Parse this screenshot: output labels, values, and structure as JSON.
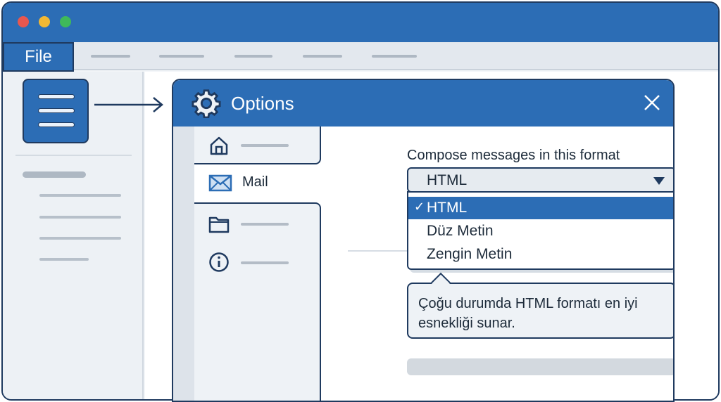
{
  "menubar": {
    "file_label": "File"
  },
  "options_dialog": {
    "title": "Options",
    "nav": {
      "mail_label": "Mail"
    },
    "compose": {
      "label": "Compose messages in this format",
      "selected_value": "HTML",
      "options": [
        "HTML",
        "Düz Metin",
        "Zengin Metin"
      ],
      "checkmark": "✓"
    },
    "tooltip_text": "Çoğu durumda HTML formatı en iyi esnekliği sunar."
  },
  "colors": {
    "accent": "#2c6db5",
    "outline": "#1f3a5f",
    "traffic_red": "#e8574f",
    "traffic_yellow": "#f2b833",
    "traffic_green": "#3fb95a"
  },
  "icons": [
    "document-lines-icon",
    "gear-icon",
    "close-icon",
    "home-icon",
    "mail-icon",
    "folder-icon",
    "info-icon",
    "arrow-right-icon",
    "dropdown-caret-icon",
    "checkmark-icon"
  ]
}
